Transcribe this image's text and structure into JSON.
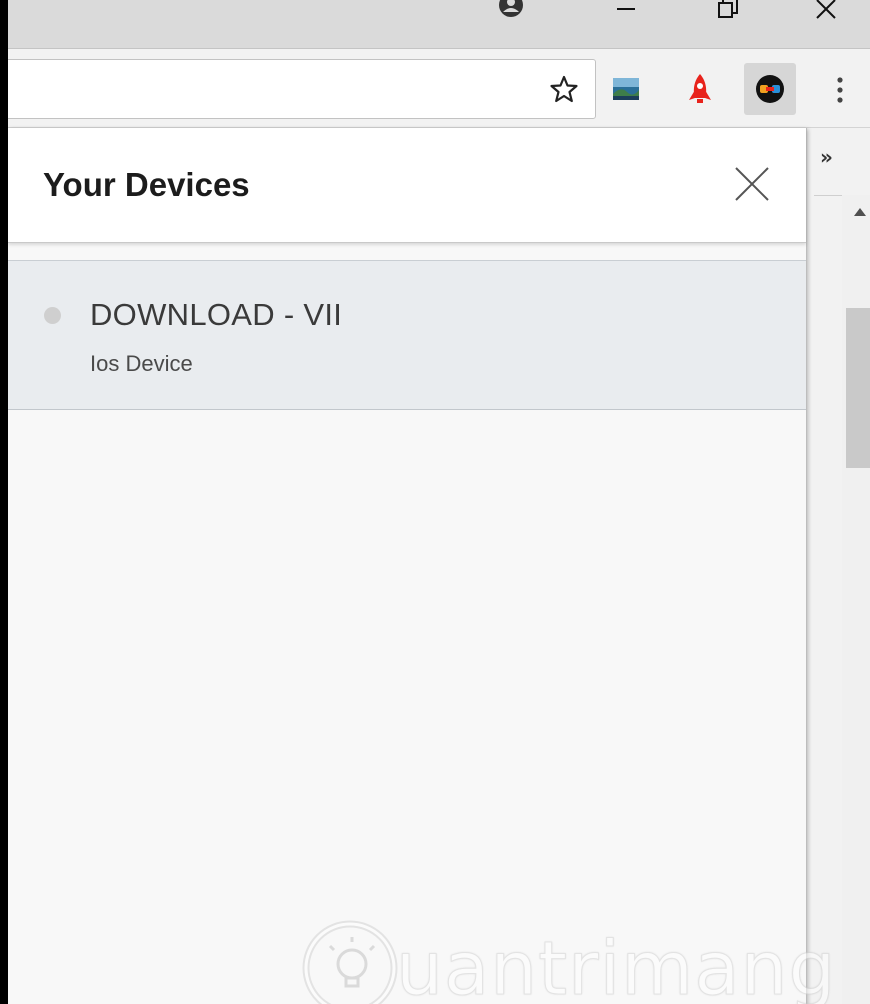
{
  "window": {
    "controls": [
      "minimize-icon",
      "restore-icon",
      "close-icon"
    ],
    "profile_icon": "avatar-icon"
  },
  "toolbar": {
    "omnibox_value": "",
    "bookmark_icon": "star-icon",
    "extensions": [
      "image-extension-icon",
      "rocket-extension-icon",
      "pushbullet-extension-icon"
    ],
    "menu_icon": "vertical-dots-icon",
    "overflow_label": "»"
  },
  "panel": {
    "title": "Your Devices",
    "close_icon": "close-icon",
    "devices": [
      {
        "name": "DOWNLOAD - VII",
        "type": "Ios Device",
        "status": "offline"
      }
    ]
  },
  "watermark": {
    "text": "uantrimang",
    "logo_icon": "lightbulb-icon"
  },
  "colors": {
    "panel_bg": "#f8f8f8",
    "device_row_bg": "#e9ecef",
    "rocket_red": "#e8231c",
    "status_dot": "#cfcfcf"
  }
}
